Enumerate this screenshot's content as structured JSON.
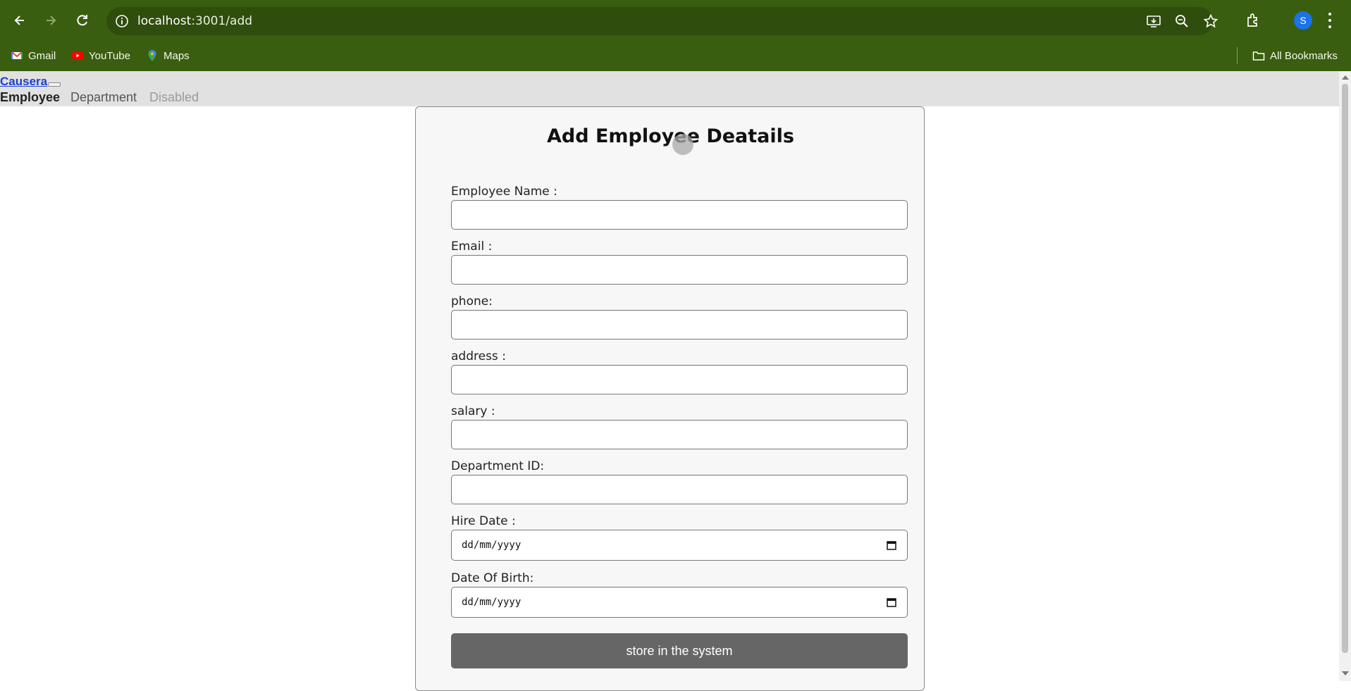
{
  "browser": {
    "url_host": "localhost",
    "url_rest": ":3001/add",
    "profile_initial": "S",
    "bookmarks": [
      {
        "label": "Gmail",
        "icon": "gmail-icon"
      },
      {
        "label": "YouTube",
        "icon": "youtube-icon"
      },
      {
        "label": "Maps",
        "icon": "maps-icon"
      }
    ],
    "all_bookmarks_label": "All Bookmarks"
  },
  "app": {
    "brand": "Causera",
    "nav": [
      {
        "label": "Employee",
        "state": "active"
      },
      {
        "label": "Department",
        "state": "normal"
      },
      {
        "label": "Disabled",
        "state": "disabled"
      }
    ]
  },
  "form": {
    "title": "Add Employee Deatails",
    "fields": [
      {
        "label": "Employee Name :",
        "value": ""
      },
      {
        "label": "Email :",
        "value": ""
      },
      {
        "label": "phone:",
        "value": ""
      },
      {
        "label": "address :",
        "value": ""
      },
      {
        "label": "salary :",
        "value": ""
      },
      {
        "label": "Department ID:",
        "value": ""
      },
      {
        "label": "Hire Date :",
        "value": "dd/mm/yyyy"
      },
      {
        "label": "Date Of Birth:",
        "value": "dd/mm/yyyy"
      }
    ],
    "submit_label": "store in the system"
  },
  "colors": {
    "chrome": "#3a5e0f",
    "header": "#e1e1e1",
    "button": "#666666",
    "brand_link": "#1b3fcf"
  }
}
